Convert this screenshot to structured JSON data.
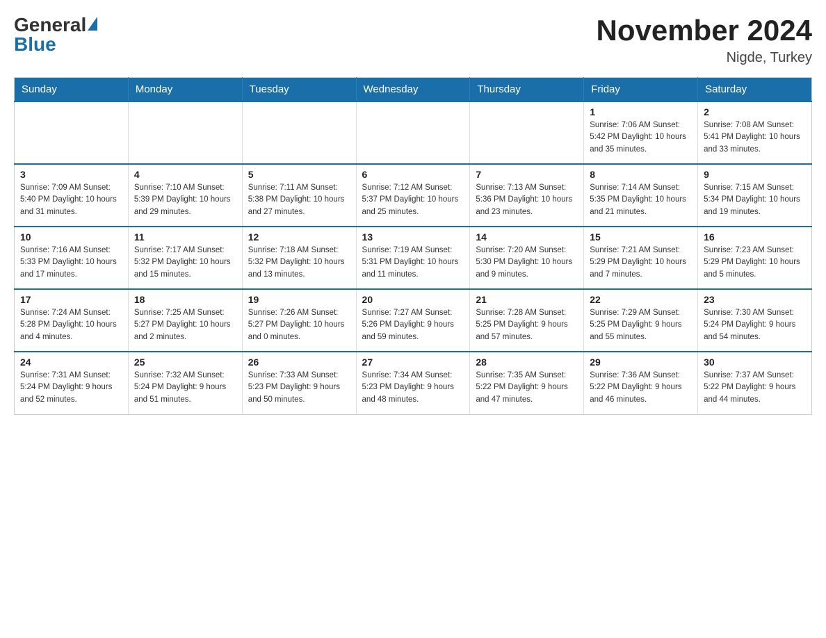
{
  "logo": {
    "general": "General",
    "blue": "Blue"
  },
  "title": "November 2024",
  "subtitle": "Nigde, Turkey",
  "days_header": [
    "Sunday",
    "Monday",
    "Tuesday",
    "Wednesday",
    "Thursday",
    "Friday",
    "Saturday"
  ],
  "weeks": [
    [
      {
        "day": "",
        "info": ""
      },
      {
        "day": "",
        "info": ""
      },
      {
        "day": "",
        "info": ""
      },
      {
        "day": "",
        "info": ""
      },
      {
        "day": "",
        "info": ""
      },
      {
        "day": "1",
        "info": "Sunrise: 7:06 AM\nSunset: 5:42 PM\nDaylight: 10 hours and 35 minutes."
      },
      {
        "day": "2",
        "info": "Sunrise: 7:08 AM\nSunset: 5:41 PM\nDaylight: 10 hours and 33 minutes."
      }
    ],
    [
      {
        "day": "3",
        "info": "Sunrise: 7:09 AM\nSunset: 5:40 PM\nDaylight: 10 hours and 31 minutes."
      },
      {
        "day": "4",
        "info": "Sunrise: 7:10 AM\nSunset: 5:39 PM\nDaylight: 10 hours and 29 minutes."
      },
      {
        "day": "5",
        "info": "Sunrise: 7:11 AM\nSunset: 5:38 PM\nDaylight: 10 hours and 27 minutes."
      },
      {
        "day": "6",
        "info": "Sunrise: 7:12 AM\nSunset: 5:37 PM\nDaylight: 10 hours and 25 minutes."
      },
      {
        "day": "7",
        "info": "Sunrise: 7:13 AM\nSunset: 5:36 PM\nDaylight: 10 hours and 23 minutes."
      },
      {
        "day": "8",
        "info": "Sunrise: 7:14 AM\nSunset: 5:35 PM\nDaylight: 10 hours and 21 minutes."
      },
      {
        "day": "9",
        "info": "Sunrise: 7:15 AM\nSunset: 5:34 PM\nDaylight: 10 hours and 19 minutes."
      }
    ],
    [
      {
        "day": "10",
        "info": "Sunrise: 7:16 AM\nSunset: 5:33 PM\nDaylight: 10 hours and 17 minutes."
      },
      {
        "day": "11",
        "info": "Sunrise: 7:17 AM\nSunset: 5:32 PM\nDaylight: 10 hours and 15 minutes."
      },
      {
        "day": "12",
        "info": "Sunrise: 7:18 AM\nSunset: 5:32 PM\nDaylight: 10 hours and 13 minutes."
      },
      {
        "day": "13",
        "info": "Sunrise: 7:19 AM\nSunset: 5:31 PM\nDaylight: 10 hours and 11 minutes."
      },
      {
        "day": "14",
        "info": "Sunrise: 7:20 AM\nSunset: 5:30 PM\nDaylight: 10 hours and 9 minutes."
      },
      {
        "day": "15",
        "info": "Sunrise: 7:21 AM\nSunset: 5:29 PM\nDaylight: 10 hours and 7 minutes."
      },
      {
        "day": "16",
        "info": "Sunrise: 7:23 AM\nSunset: 5:29 PM\nDaylight: 10 hours and 5 minutes."
      }
    ],
    [
      {
        "day": "17",
        "info": "Sunrise: 7:24 AM\nSunset: 5:28 PM\nDaylight: 10 hours and 4 minutes."
      },
      {
        "day": "18",
        "info": "Sunrise: 7:25 AM\nSunset: 5:27 PM\nDaylight: 10 hours and 2 minutes."
      },
      {
        "day": "19",
        "info": "Sunrise: 7:26 AM\nSunset: 5:27 PM\nDaylight: 10 hours and 0 minutes."
      },
      {
        "day": "20",
        "info": "Sunrise: 7:27 AM\nSunset: 5:26 PM\nDaylight: 9 hours and 59 minutes."
      },
      {
        "day": "21",
        "info": "Sunrise: 7:28 AM\nSunset: 5:25 PM\nDaylight: 9 hours and 57 minutes."
      },
      {
        "day": "22",
        "info": "Sunrise: 7:29 AM\nSunset: 5:25 PM\nDaylight: 9 hours and 55 minutes."
      },
      {
        "day": "23",
        "info": "Sunrise: 7:30 AM\nSunset: 5:24 PM\nDaylight: 9 hours and 54 minutes."
      }
    ],
    [
      {
        "day": "24",
        "info": "Sunrise: 7:31 AM\nSunset: 5:24 PM\nDaylight: 9 hours and 52 minutes."
      },
      {
        "day": "25",
        "info": "Sunrise: 7:32 AM\nSunset: 5:24 PM\nDaylight: 9 hours and 51 minutes."
      },
      {
        "day": "26",
        "info": "Sunrise: 7:33 AM\nSunset: 5:23 PM\nDaylight: 9 hours and 50 minutes."
      },
      {
        "day": "27",
        "info": "Sunrise: 7:34 AM\nSunset: 5:23 PM\nDaylight: 9 hours and 48 minutes."
      },
      {
        "day": "28",
        "info": "Sunrise: 7:35 AM\nSunset: 5:22 PM\nDaylight: 9 hours and 47 minutes."
      },
      {
        "day": "29",
        "info": "Sunrise: 7:36 AM\nSunset: 5:22 PM\nDaylight: 9 hours and 46 minutes."
      },
      {
        "day": "30",
        "info": "Sunrise: 7:37 AM\nSunset: 5:22 PM\nDaylight: 9 hours and 44 minutes."
      }
    ]
  ]
}
